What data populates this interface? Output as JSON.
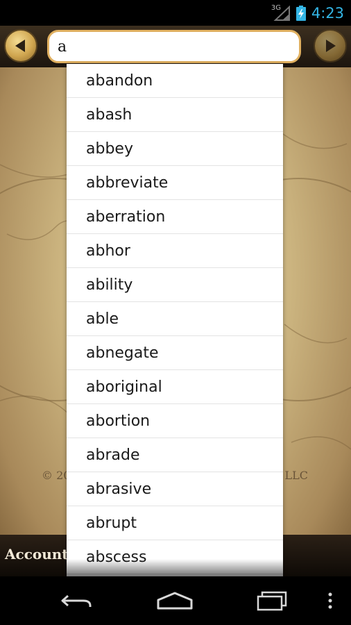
{
  "status_bar": {
    "network": "3G",
    "time": "4:23",
    "time_color": "#33b5e5"
  },
  "toolbar": {
    "back_icon": "left-arrow-icon",
    "forward_icon": "right-arrow-icon",
    "search_value": "a"
  },
  "suggestions": [
    "abandon",
    "abash",
    "abbey",
    "abbreviate",
    "aberration",
    "abhor",
    "ability",
    "able",
    "abnegate",
    "aboriginal",
    "abortion",
    "abrade",
    "abrasive",
    "abrupt",
    "abscess"
  ],
  "footer": {
    "copyright_left": "© 20",
    "copyright_right": "LLC",
    "account_label": "Account"
  },
  "nav": {
    "back_icon": "back-icon",
    "home_icon": "home-icon",
    "recents_icon": "recents-icon",
    "menu_icon": "overflow-menu-icon"
  }
}
